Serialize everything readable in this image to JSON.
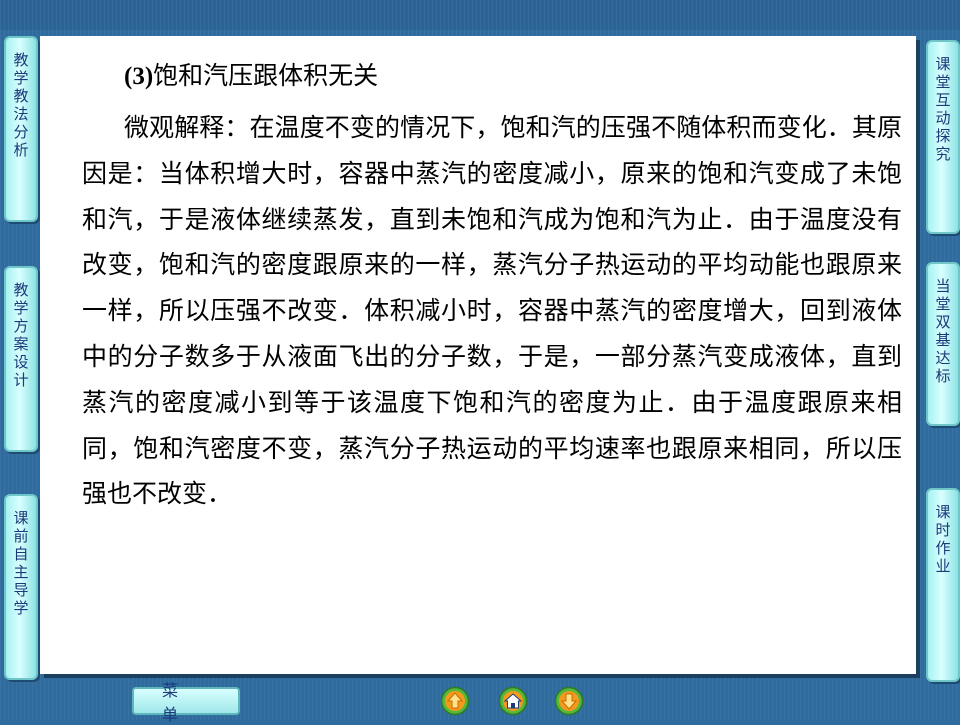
{
  "left_nav": [
    {
      "label": "教学教法分析"
    },
    {
      "label": "教学方案设计"
    },
    {
      "label": "课前自主导学"
    }
  ],
  "right_nav": [
    {
      "label": "课堂互动探究"
    },
    {
      "label": "当堂双基达标"
    },
    {
      "label": "课时作业"
    }
  ],
  "content": {
    "title_number": "(3)",
    "title_text": "饱和汽压跟体积无关",
    "body": "微观解释：在温度不变的情况下，饱和汽的压强不随体积而变化．其原因是：当体积增大时，容器中蒸汽的密度减小，原来的饱和汽变成了未饱和汽，于是液体继续蒸发，直到未饱和汽成为饱和汽为止．由于温度没有改变，饱和汽的密度跟原来的一样，蒸汽分子热运动的平均动能也跟原来一样，所以压强不改变．体积减小时，容器中蒸汽的密度增大，回到液体中的分子数多于从液面飞出的分子数，于是，一部分蒸汽变成液体，直到蒸汽的密度减小到等于该温度下饱和汽的密度为止．由于温度跟原来相同，饱和汽密度不变，蒸汽分子热运动的平均速率也跟原来相同，所以压强也不改变．"
  },
  "bottom": {
    "menu_label": "菜单",
    "prev_icon": "arrow-up-icon",
    "home_icon": "home-icon",
    "next_icon": "arrow-down-icon"
  },
  "colors": {
    "background": "#2e6b9e",
    "tab_fill": "#c5fbfb",
    "tab_text": "#1a3a7a",
    "nav_orange": "#f39a1e",
    "nav_green": "#55b83a"
  }
}
